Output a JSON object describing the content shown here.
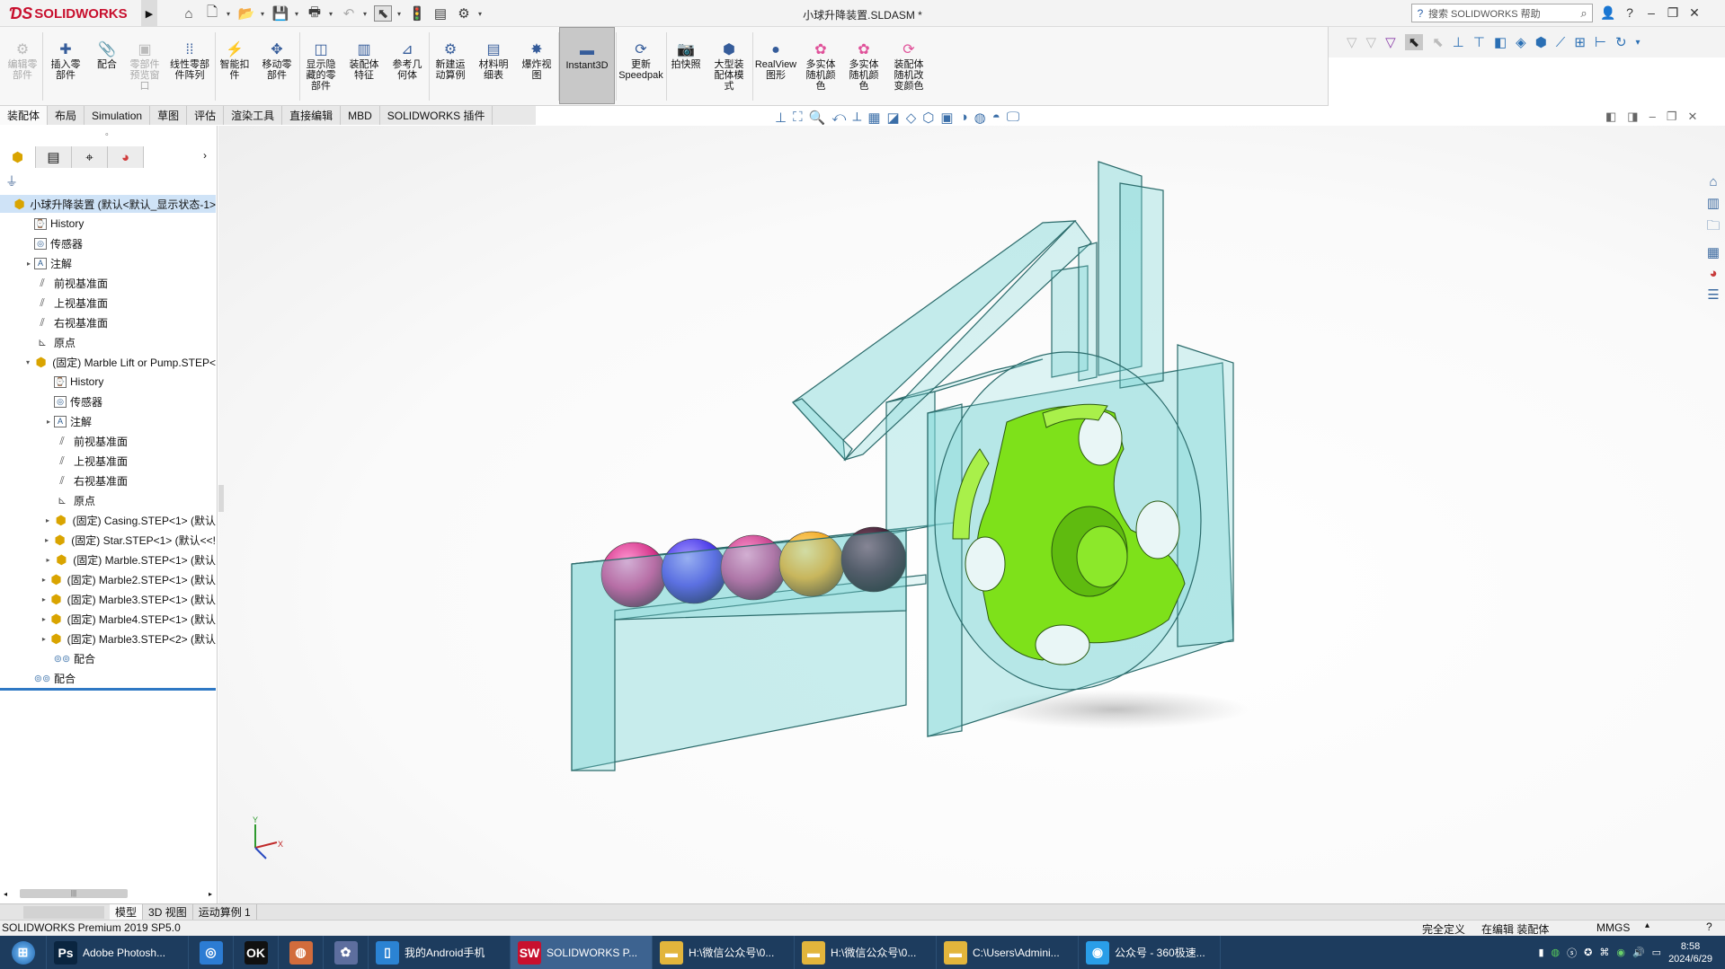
{
  "app": {
    "brand": "SOLIDWORKS",
    "doc_title": "小球升降装置.SLDASM *",
    "search_placeholder": "搜索 SOLIDWORKS 帮助"
  },
  "ribbon": [
    {
      "label": "编辑零\n部件",
      "icon": "edit-component-icon",
      "disabled": true
    },
    {
      "label": "插入零\n部件",
      "icon": "insert-component-icon",
      "disabled": false
    },
    {
      "label": "配合",
      "icon": "mate-icon",
      "disabled": false
    },
    {
      "label": "零部件\n预览窗\n口",
      "icon": "component-preview-icon",
      "disabled": true
    },
    {
      "label": "线性零部\n件阵列",
      "icon": "linear-pattern-icon",
      "disabled": false
    },
    {
      "label": "智能扣\n件",
      "icon": "smart-fastener-icon",
      "disabled": false
    },
    {
      "label": "移动零\n部件",
      "icon": "move-component-icon",
      "disabled": false
    },
    {
      "label": "显示隐\n藏的零\n部件",
      "icon": "show-hidden-icon",
      "disabled": false
    },
    {
      "label": "装配体\n特征",
      "icon": "assembly-feature-icon",
      "disabled": false
    },
    {
      "label": "参考几\n何体",
      "icon": "reference-geometry-icon",
      "disabled": false
    },
    {
      "label": "新建运\n动算例",
      "icon": "motion-study-icon",
      "disabled": false
    },
    {
      "label": "材料明\n细表",
      "icon": "bom-icon",
      "disabled": false
    },
    {
      "label": "爆炸视\n图",
      "icon": "exploded-view-icon",
      "disabled": false
    },
    {
      "label": "Instant3D",
      "icon": "instant3d-icon",
      "disabled": false,
      "active": true
    },
    {
      "label": "更新\nSpeedpak",
      "icon": "speedpak-icon",
      "disabled": false
    },
    {
      "label": "拍快照",
      "icon": "snapshot-icon",
      "disabled": false
    },
    {
      "label": "大型装\n配体模\n式",
      "icon": "large-assembly-icon",
      "disabled": false
    },
    {
      "label": "RealView\n图形",
      "icon": "realview-icon",
      "disabled": false
    },
    {
      "label": "多实体\n随机颜\n色",
      "icon": "random-color-icon",
      "disabled": false
    },
    {
      "label": "多实体\n随机颜\n色",
      "icon": "random-color-icon",
      "disabled": false
    },
    {
      "label": "装配体\n随机改\n变颜色",
      "icon": "assembly-color-icon",
      "disabled": false
    }
  ],
  "command_tabs": [
    "装配体",
    "布局",
    "Simulation",
    "草图",
    "评估",
    "渲染工具",
    "直接编辑",
    "MBD",
    "SOLIDWORKS 插件"
  ],
  "tree": [
    {
      "label": "小球升降装置 (默认<默认_显示状态-1>",
      "icon": "assembly",
      "level": 0,
      "exp": "",
      "root": true
    },
    {
      "label": "History",
      "icon": "history",
      "level": 1,
      "exp": ""
    },
    {
      "label": "传感器",
      "icon": "sensor",
      "level": 1,
      "exp": ""
    },
    {
      "label": "注解",
      "icon": "annotation",
      "level": 1,
      "exp": "▸"
    },
    {
      "label": "前视基准面",
      "icon": "plane",
      "level": 1,
      "exp": ""
    },
    {
      "label": "上视基准面",
      "icon": "plane",
      "level": 1,
      "exp": ""
    },
    {
      "label": "右视基准面",
      "icon": "plane",
      "level": 1,
      "exp": ""
    },
    {
      "label": "原点",
      "icon": "origin",
      "level": 1,
      "exp": ""
    },
    {
      "label": "(固定) Marble Lift or Pump.STEP<",
      "icon": "assembly",
      "level": 1,
      "exp": "▾"
    },
    {
      "label": "History",
      "icon": "history",
      "level": 2,
      "exp": ""
    },
    {
      "label": "传感器",
      "icon": "sensor",
      "level": 2,
      "exp": ""
    },
    {
      "label": "注解",
      "icon": "annotation",
      "level": 2,
      "exp": "▸"
    },
    {
      "label": "前视基准面",
      "icon": "plane",
      "level": 2,
      "exp": ""
    },
    {
      "label": "上视基准面",
      "icon": "plane",
      "level": 2,
      "exp": ""
    },
    {
      "label": "右视基准面",
      "icon": "plane",
      "level": 2,
      "exp": ""
    },
    {
      "label": "原点",
      "icon": "origin",
      "level": 2,
      "exp": ""
    },
    {
      "label": "(固定) Casing.STEP<1> (默认",
      "icon": "assembly",
      "level": 2,
      "exp": "▸"
    },
    {
      "label": "(固定) Star.STEP<1> (默认<<!",
      "icon": "assembly",
      "level": 2,
      "exp": "▸"
    },
    {
      "label": "(固定) Marble.STEP<1> (默认",
      "icon": "assembly",
      "level": 2,
      "exp": "▸"
    },
    {
      "label": "(固定) Marble2.STEP<1> (默认",
      "icon": "assembly",
      "level": 2,
      "exp": "▸"
    },
    {
      "label": "(固定) Marble3.STEP<1> (默认",
      "icon": "assembly",
      "level": 2,
      "exp": "▸"
    },
    {
      "label": "(固定) Marble4.STEP<1> (默认",
      "icon": "assembly",
      "level": 2,
      "exp": "▸"
    },
    {
      "label": "(固定) Marble3.STEP<2> (默认",
      "icon": "assembly",
      "level": 2,
      "exp": "▸"
    },
    {
      "label": "配合",
      "icon": "mate",
      "level": 2,
      "exp": ""
    },
    {
      "label": "配合",
      "icon": "mate",
      "level": 1,
      "exp": ""
    }
  ],
  "bottom_tabs": [
    "模型",
    "3D 视图",
    "运动算例 1"
  ],
  "status": {
    "product": "SOLIDWORKS Premium 2019 SP5.0",
    "definition": "完全定义",
    "mode": "在编辑 装配体",
    "units": "MMGS"
  },
  "taskbar": [
    {
      "label": "",
      "icon": "start-orb"
    },
    {
      "label": "Adobe Photosh...",
      "icon": "photoshop-icon",
      "badge": "Ps",
      "color": "#0a2540"
    },
    {
      "label": "",
      "icon": "pinned-app-icon",
      "badge": "◎",
      "color": "#2c7cd3"
    },
    {
      "label": "",
      "icon": "pinned-app-icon",
      "badge": "OK",
      "color": "#111111"
    },
    {
      "label": "",
      "icon": "pinned-app-icon",
      "badge": "◍",
      "color": "#d26c3c"
    },
    {
      "label": "",
      "icon": "pinned-app-icon",
      "badge": "✿",
      "color": "#5d6e9e"
    },
    {
      "label": "我的Android手机",
      "icon": "phone-icon",
      "badge": "▯",
      "color": "#2b83d3"
    },
    {
      "label": "SOLIDWORKS P...",
      "icon": "solidworks-icon",
      "badge": "SW",
      "color": "#c8102e",
      "active": true
    },
    {
      "label": "H:\\微信公众号\\0...",
      "icon": "folder-icon",
      "badge": "▬",
      "color": "#e2b53c"
    },
    {
      "label": "H:\\微信公众号\\0...",
      "icon": "folder-icon",
      "badge": "▬",
      "color": "#e2b53c"
    },
    {
      "label": "C:\\Users\\Admini...",
      "icon": "folder-icon",
      "badge": "▬",
      "color": "#e2b53c"
    },
    {
      "label": "公众号 - 360极速...",
      "icon": "browser-icon",
      "badge": "◉",
      "color": "#2a9ee8"
    }
  ],
  "clock": {
    "time": "8:58",
    "date": "2024/6/29"
  },
  "colors": {
    "casing": "#7fd6d6",
    "star": "#7ee11a",
    "marbles": [
      "#d6378c",
      "#4a3ae8",
      "#c8438f",
      "#f0a51c",
      "#3c1c30"
    ]
  }
}
